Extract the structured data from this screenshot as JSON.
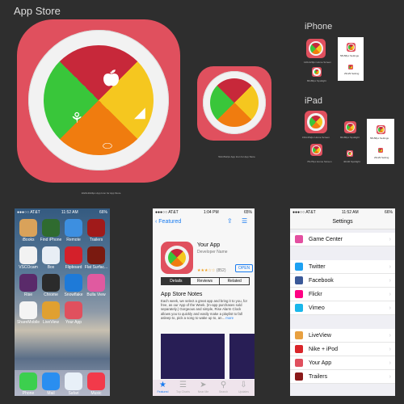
{
  "sections": {
    "app_store": "App Store",
    "iphone": "iPhone",
    "ipad": "iPad"
  },
  "captions": {
    "large_icon": "1024x1024px App Icon for App Store",
    "medium_icon": "512x512px App Icon for App Store",
    "iphone_home": "120x120px Home Screen",
    "iphone_spotlight": "80x80px Spotlight",
    "iphone_settings_2x": "58x58px Settings",
    "iphone_settings_1x": "29x29 Setting",
    "ipad_home": "152x152px Home Screen",
    "ipad_spotlight_2x": "80x80px Spotlight",
    "ipad_home_1x": "76x76px Home Screen",
    "ipad_spotlight_1x": "40x40 Spotlight",
    "ipad_settings_2x": "58x58px Settings",
    "ipad_settings_1x": "29x29 Setting"
  },
  "icon_colors": {
    "background": "#e0505e",
    "fruit": "#c7283a",
    "dairy": "#f5c71f",
    "protein": "#f07c0f",
    "grain": "#39c63a"
  },
  "home_screen": {
    "status": {
      "carrier": "●●●○○ AT&T",
      "time": "11:52 AM",
      "battery": "66%"
    },
    "apps": [
      {
        "label": "iBooks",
        "color": "#d9a25a"
      },
      {
        "label": "Find iPhone",
        "color": "#2f6b2f"
      },
      {
        "label": "Remote",
        "color": "#3d8fe0"
      },
      {
        "label": "Trailers",
        "color": "#a01a1a"
      },
      {
        "label": "VSCOcam",
        "color": "#f2f2f2"
      },
      {
        "label": "Box",
        "color": "#e8eef5"
      },
      {
        "label": "Flipboard",
        "color": "#d4202a"
      },
      {
        "label": "Flat Surfac...",
        "color": "#7a1a10"
      },
      {
        "label": "Rise",
        "color": "#5a2a6a"
      },
      {
        "label": "Chrome",
        "color": "#2b2b2b"
      },
      {
        "label": "Snowflake",
        "color": "#1e7ad8"
      },
      {
        "label": "Bulla View",
        "color": "#e05aa0"
      },
      {
        "label": "ShareMobile",
        "color": "#f4f4f4"
      },
      {
        "label": "LiveView",
        "color": "#e0a030"
      },
      {
        "label": "Your App",
        "color": "#e0505e"
      }
    ],
    "dock": [
      {
        "label": "Phone",
        "color": "#3ccf4e"
      },
      {
        "label": "Mail",
        "color": "#2a8ef0"
      },
      {
        "label": "Safari",
        "color": "#e8f0f8"
      },
      {
        "label": "Music",
        "color": "#f23a4a"
      }
    ]
  },
  "store_page": {
    "status": {
      "carrier": "●●●○○ AT&T",
      "time": "1:04 PM",
      "battery": "65%"
    },
    "back_label": "Featured",
    "app_name": "Your App",
    "developer": "Developer Name",
    "rating_stars": 3.5,
    "rating_count": "(852)",
    "open_label": "OPEN",
    "segments": [
      "Details",
      "Reviews",
      "Related"
    ],
    "notes_title": "App Store Notes",
    "notes_body": "Each week, we select a great app and bring it to you, for free, as our App of the Week. (In-app purchases sold separately.) Gorgeous and simple, Rise Alarm Clock allows you to quickly and easily make a playlist to fall asleep to, pick a song to wake up to, an...",
    "more_label": "more",
    "tabs": [
      "Featured",
      "Top Charts",
      "Near Me",
      "Search",
      "Updates"
    ]
  },
  "settings_page": {
    "status": {
      "carrier": "●●●○○ AT&T",
      "time": "11:52 AM",
      "battery": "66%"
    },
    "title": "Settings",
    "groups": [
      [
        {
          "label": "Game Center",
          "color": "#e34fa0"
        }
      ],
      [
        {
          "label": "Twitter",
          "color": "#1da1f2"
        },
        {
          "label": "Facebook",
          "color": "#3b5998"
        },
        {
          "label": "Flickr",
          "color": "#ff0084"
        },
        {
          "label": "Vimeo",
          "color": "#1ab7ea"
        }
      ],
      [
        {
          "label": "LiveView",
          "color": "#e8a040"
        },
        {
          "label": "Nike + iPod",
          "color": "#d9252a"
        },
        {
          "label": "Your App",
          "color": "#e0505e"
        },
        {
          "label": "Trailers",
          "color": "#8a1a1a"
        }
      ]
    ]
  }
}
